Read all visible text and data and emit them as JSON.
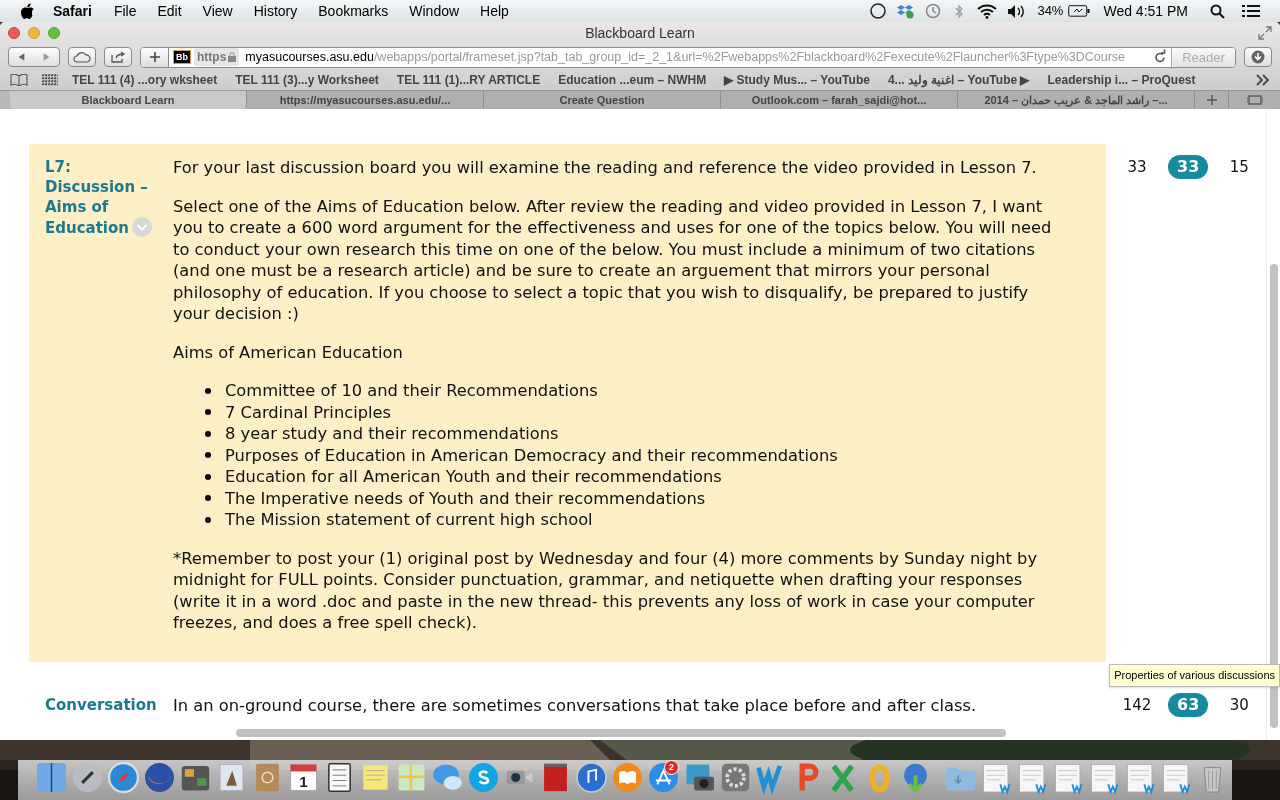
{
  "menu_bar": {
    "app": "Safari",
    "menus": [
      "File",
      "Edit",
      "View",
      "History",
      "Bookmarks",
      "Window",
      "Help"
    ],
    "battery": "34%",
    "clock": "Wed 4:51 PM"
  },
  "window": {
    "title": "Blackboard Learn"
  },
  "toolbar": {
    "site_icon": "Bb",
    "scheme": "https",
    "host": "myasucourses.asu.edu",
    "path": "/webapps/portal/frameset.jsp?tab_tab_group_id=_2_1&url=%2Fwebapps%2Fblackboard%2Fexecute%2Flauncher%3Ftype%3DCourse",
    "reader": "Reader",
    "reader_disabled": true
  },
  "bookmarks": [
    "TEL 111 (4) ...ory wksheet",
    "TEL 111 (3)...y Worksheet",
    "TEL 111 (1)...RY ARTICLE",
    "Education ...eum – NWHM",
    "▶ Study Mus... – YouTube",
    "4... اغنية وليد – YouTube ▶",
    "Leadership i... – ProQuest"
  ],
  "tabs": [
    {
      "label": "Blackboard Learn",
      "selected": true
    },
    {
      "label": "https://myasucourses.asu.edu/...",
      "selected": false
    },
    {
      "label": "Create Question",
      "selected": false
    },
    {
      "label": "Outlook.com – farah_sajdi@hot...",
      "selected": false
    },
    {
      "label": "راشد الماجد & عريب حمدان – 2014 –...",
      "selected": false
    }
  ],
  "forums": [
    {
      "title": "L7: Discussion – Aims of Education",
      "highlighted": true,
      "has_menu": true,
      "paragraphs": [
        "For your last discussion board you will examine the reading and reference the video provided in Lesson 7.",
        "Select one of the Aims of Education below. After review the reading and video provided in Lesson 7, I want you to create a 600 word argument for the effectiveness and uses for one of the topics below.  You will need to conduct your own research this time on one of the below.  You must include a minimum of two citations (and one must be a research article) and be sure to create an arguement that mirrors your personal philosophy of education.  If you choose to select a topic that you wish to disqualify, be prepared to justify your decision :)",
        "Aims of American Education"
      ],
      "list": [
        "Committee of 10 and their Recommendations",
        "7 Cardinal Principles",
        "8 year study and their recommendations",
        "Purposes of Education in American Democracy and their recommendations",
        "Education for all American Youth and their recommendations",
        "The Imperative needs of Youth and their recommendations",
        "The Mission statement of current high school"
      ],
      "closing": "*Remember to post your (1) original post by Wednesday and four (4) more comments by Sunday night by midnight for FULL points. Consider punctuation, grammar, and netiquette when drafting your responses (write it in a word .doc and paste in the new thread- this prevents any loss of work in case your computer freezes, and does a free spell check).",
      "total": "33",
      "unread": "33",
      "participants": "15"
    },
    {
      "title": "Conversation",
      "highlighted": false,
      "has_menu": false,
      "paragraphs": [
        "In an on-ground course, there are sometimes conversations that take place before and after class."
      ],
      "total": "142",
      "unread": "63",
      "participants": "30"
    }
  ],
  "tooltip": "Properties of various discussions",
  "dock": {
    "calendar_day": "1",
    "app_store_badge": "2"
  }
}
